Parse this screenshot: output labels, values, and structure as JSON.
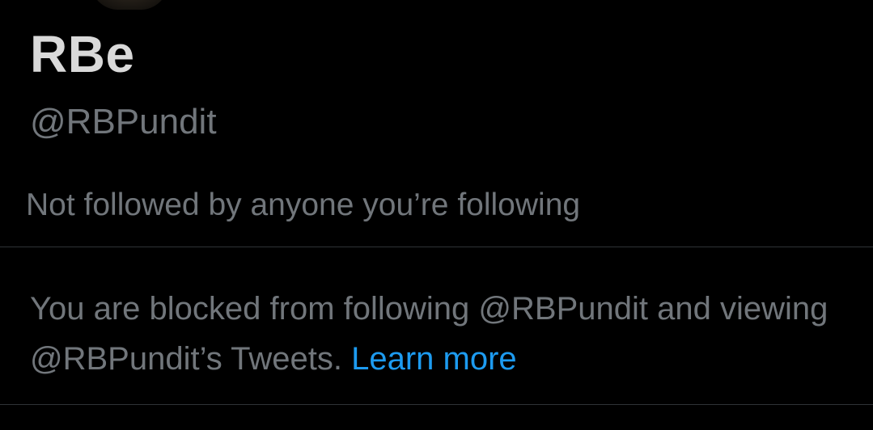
{
  "profile": {
    "display_name": "RBe",
    "handle": "@RBPundit",
    "followed_by": "Not followed by anyone you’re following"
  },
  "blocked_notice": {
    "text": "You are blocked from following @RBPundit and viewing @RBPundit’s Tweets.",
    "link_label": "Learn more"
  },
  "colors": {
    "background": "#000000",
    "primary_text": "#d9d9d9",
    "secondary_text": "#71767b",
    "link": "#1d9bf0",
    "divider": "#2f3336"
  }
}
